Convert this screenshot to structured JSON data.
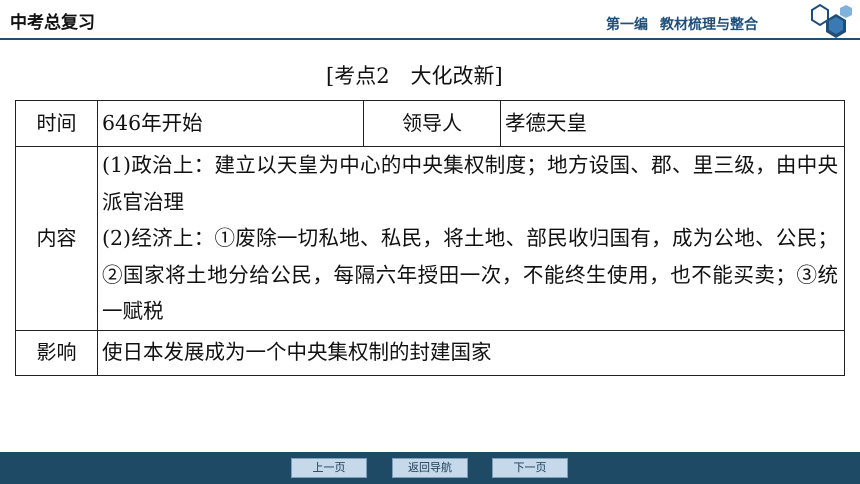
{
  "header": {
    "title": "中考总复习",
    "chapter": "第一编",
    "section": "教材梳理与整合"
  },
  "main": {
    "section_title": "[考点2　大化改新]",
    "rows": {
      "time": {
        "label": "时间",
        "value": "646年开始"
      },
      "leader": {
        "label": "领导人",
        "value": "孝德天皇"
      },
      "content": {
        "label": "内容",
        "items": [
          "(1)政治上：建立以天皇为中心的中央集权制度；地方设国、郡、里三级，由中央派官治理",
          "(2)经济上：①废除一切私地、私民，将土地、部民收归国有，成为公地、公民；②国家将土地分给公民，每隔六年授田一次，不能终生使用，也不能买卖；③统一赋税"
        ]
      },
      "impact": {
        "label": "影响",
        "value": "使日本发展成为一个中央集权制的封建国家"
      }
    }
  },
  "footer": {
    "prev": "上一页",
    "home": "返回导航",
    "next": "下一页"
  },
  "colors": {
    "accent": "#1f4e79",
    "footer_bg": "#1f4a66",
    "button_bg": "#c5d9ea"
  }
}
